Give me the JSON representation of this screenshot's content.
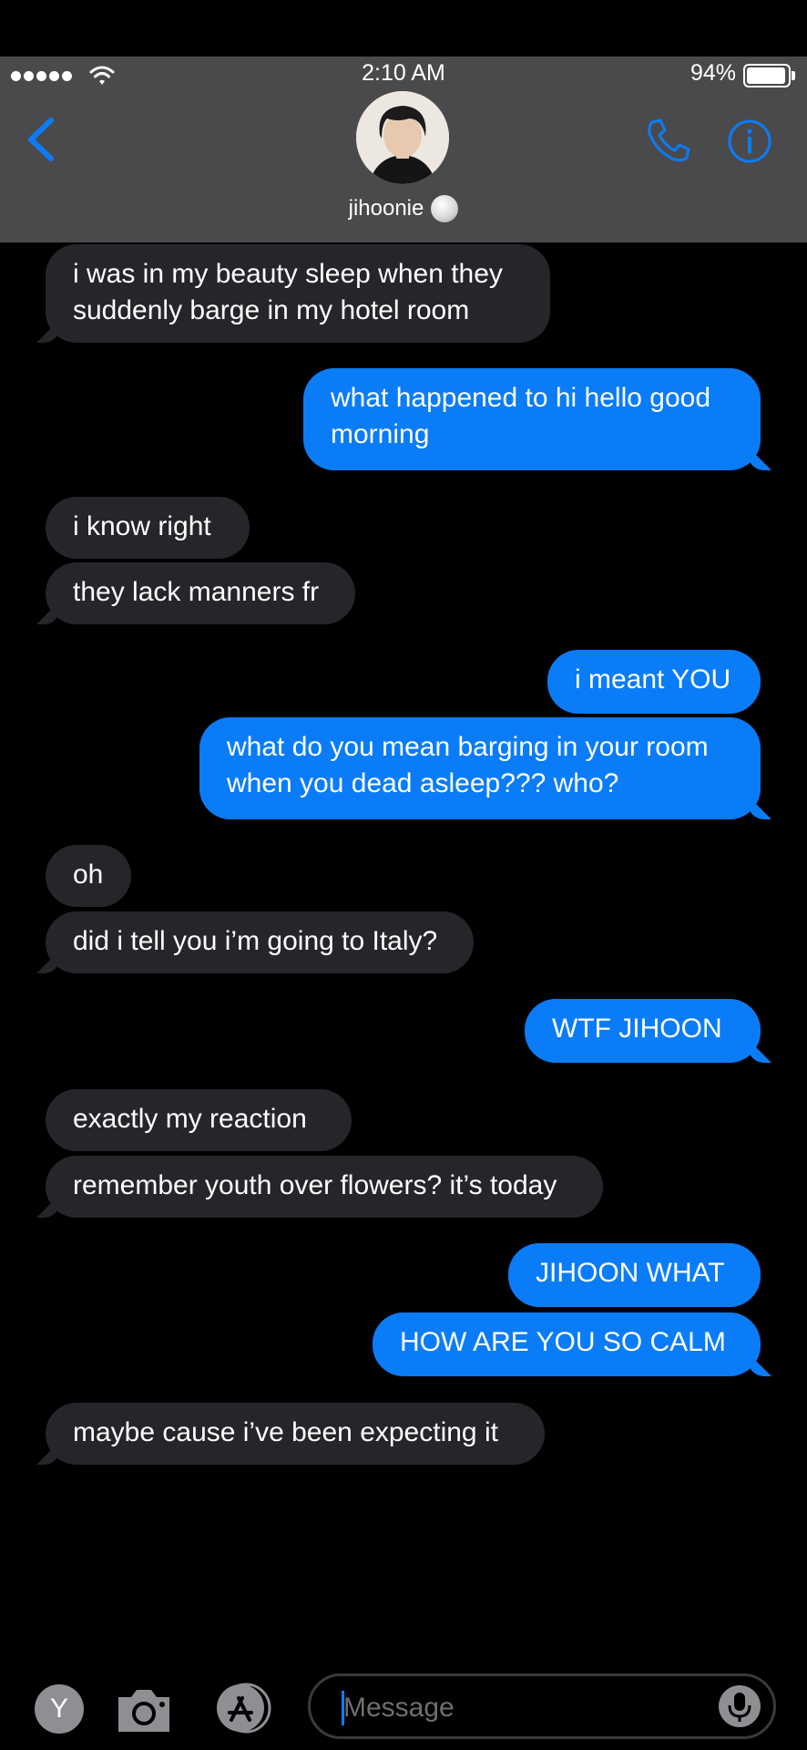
{
  "status_bar": {
    "time": "2:10 AM",
    "battery": "94%"
  },
  "header": {
    "contact_name": "jihoonie"
  },
  "messages": [
    {
      "from": "them",
      "text": "i was in my beauty sleep when they\nsuddenly barge in my hotel room"
    },
    {
      "from": "me",
      "text": "what happened to hi hello good\nmorning"
    },
    {
      "from": "them",
      "text": "i know right"
    },
    {
      "from": "them",
      "text": "they lack manners fr"
    },
    {
      "from": "me",
      "text": "i meant YOU"
    },
    {
      "from": "me",
      "text": "what do you mean barging in your room\nwhen you dead asleep??? who?"
    },
    {
      "from": "them",
      "text": "oh"
    },
    {
      "from": "them",
      "text": "did i tell you i’m going to Italy?"
    },
    {
      "from": "me",
      "text": "WTF JIHOON"
    },
    {
      "from": "them",
      "text": "exactly my reaction"
    },
    {
      "from": "them",
      "text": "remember youth over flowers? it’s today"
    },
    {
      "from": "me",
      "text": "JIHOON WHAT"
    },
    {
      "from": "me",
      "text": "HOW ARE YOU SO CALM"
    },
    {
      "from": "them",
      "text": "maybe cause i’ve been expecting it"
    }
  ],
  "compose": {
    "placeholder": "Message",
    "apps_button": "Y"
  },
  "colors": {
    "outgoing": "#0b7cf7",
    "incoming": "#262529",
    "header": "#4a4a4c",
    "accent": "#0b7cf7"
  }
}
